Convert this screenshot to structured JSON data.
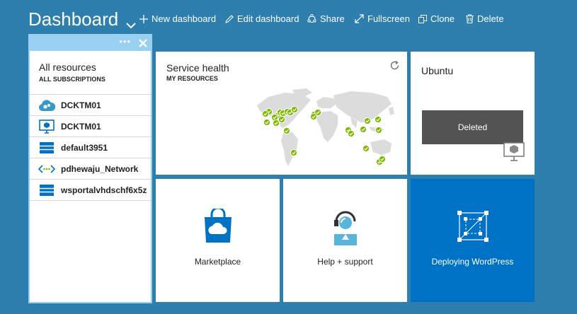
{
  "header": {
    "title": "Dashboard",
    "commands": [
      {
        "label": "New dashboard"
      },
      {
        "label": "Edit dashboard"
      },
      {
        "label": "Share"
      },
      {
        "label": "Fullscreen"
      },
      {
        "label": "Clone"
      },
      {
        "label": "Delete"
      }
    ]
  },
  "blade": {
    "title": "All resources",
    "subtitle": "ALL SUBSCRIPTIONS",
    "items": [
      {
        "name": "DCKTM01",
        "icon": "cloud-service-icon"
      },
      {
        "name": "DCKTM01",
        "icon": "virtual-machine-icon"
      },
      {
        "name": "default3951",
        "icon": "storage-account-icon"
      },
      {
        "name": "pdhewaju_Network",
        "icon": "virtual-network-icon"
      },
      {
        "name": "wsportalvhdschf6x5z",
        "icon": "storage-account-icon"
      }
    ]
  },
  "service_health": {
    "title": "Service health",
    "subtitle": "MY RESOURCES"
  },
  "ubuntu": {
    "title": "Ubuntu",
    "status": "Deleted"
  },
  "marketplace": {
    "label": "Marketplace"
  },
  "help": {
    "label": "Help + support"
  },
  "deploying": {
    "label": "Deploying WordPress"
  },
  "colors": {
    "background": "#2e7eae",
    "accent": "#0072c6",
    "status_ok": "#7fba00",
    "blade_border": "#99cff0"
  }
}
